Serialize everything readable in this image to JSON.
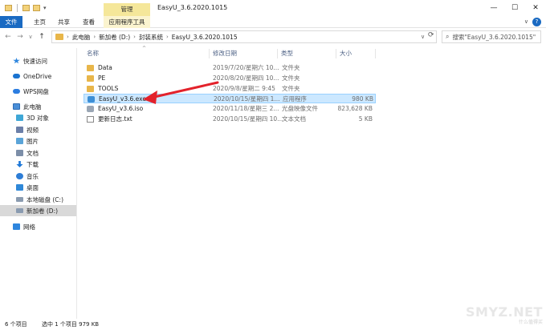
{
  "window": {
    "title": "EasyU_3.6.2020.1015",
    "context_tab_group": "管理",
    "controls": [
      "—",
      "☐",
      "✕"
    ]
  },
  "quick_access_toolbar": {
    "dropdown": "▾"
  },
  "ribbon": {
    "tabs": [
      "文件",
      "主页",
      "共享",
      "查看",
      "应用程序工具"
    ],
    "collapse_glyph": "∨",
    "help_glyph": "?"
  },
  "navigation": {
    "back": "←",
    "forward": "→",
    "recent": "∨",
    "up": "↑"
  },
  "address_bar": {
    "crumbs": [
      "此电脑",
      "新加卷 (D:)",
      "封装系统",
      "EasyU_3.6.2020.1015"
    ],
    "separator": "›",
    "dropdown": "∨",
    "refresh": "⟳"
  },
  "search": {
    "placeholder": "搜索\"EasyU_3.6.2020.1015\"",
    "icon": "⌕"
  },
  "sidebar": {
    "items": [
      {
        "label": "快速访问",
        "icon": "star-icon"
      },
      {
        "label": "OneDrive",
        "icon": "cloud-icon"
      },
      {
        "label": "WPS网盘",
        "icon": "wps-cloud-icon"
      },
      {
        "label": "此电脑",
        "icon": "computer-icon"
      },
      {
        "label": "3D 对象",
        "icon": "cube-icon"
      },
      {
        "label": "视频",
        "icon": "video-icon"
      },
      {
        "label": "图片",
        "icon": "picture-icon"
      },
      {
        "label": "文档",
        "icon": "document-icon"
      },
      {
        "label": "下载",
        "icon": "download-icon"
      },
      {
        "label": "音乐",
        "icon": "music-icon"
      },
      {
        "label": "桌面",
        "icon": "desktop-icon"
      },
      {
        "label": "本地磁盘 (C:)",
        "icon": "drive-icon"
      },
      {
        "label": "新加卷 (D:)",
        "icon": "drive-icon"
      },
      {
        "label": "网络",
        "icon": "network-icon"
      }
    ],
    "selected": "新加卷 (D:)"
  },
  "file_list": {
    "columns": [
      "名称",
      "修改日期",
      "类型",
      "大小"
    ],
    "sort_caret": "^",
    "rows": [
      {
        "name": "Data",
        "date": "2019/7/20/星期六 10...",
        "type": "文件夹",
        "size": "",
        "icon": "folder-icon"
      },
      {
        "name": "PE",
        "date": "2020/8/20/星期四 10...",
        "type": "文件夹",
        "size": "",
        "icon": "folder-icon"
      },
      {
        "name": "TOOLS",
        "date": "2020/9/8/星期二 9:45",
        "type": "文件夹",
        "size": "",
        "icon": "folder-icon"
      },
      {
        "name": "EasyU_v3.6.exe",
        "date": "2020/10/15/星期四 1...",
        "type": "应用程序",
        "size": "980 KB",
        "icon": "exe-icon",
        "selected": true
      },
      {
        "name": "EasyU_v3.6.iso",
        "date": "2020/11/18/星期三 2...",
        "type": "光盘映像文件",
        "size": "823,628 KB",
        "icon": "disc-image-icon"
      },
      {
        "name": "更新日志.txt",
        "date": "2020/10/15/星期四 10...",
        "type": "文本文档",
        "size": "5 KB",
        "icon": "text-file-icon"
      }
    ]
  },
  "status_bar": {
    "item_count": "6 个项目",
    "selection": "选中 1 个项目  979 KB"
  },
  "watermark": {
    "text": "SMYZ.NET",
    "sub": "什么值得买"
  },
  "colors": {
    "accent": "#1a6ac2",
    "selection_bg": "#cce8ff",
    "context_tab": "#f5e79a",
    "annotation_arrow": "#e3222b"
  }
}
